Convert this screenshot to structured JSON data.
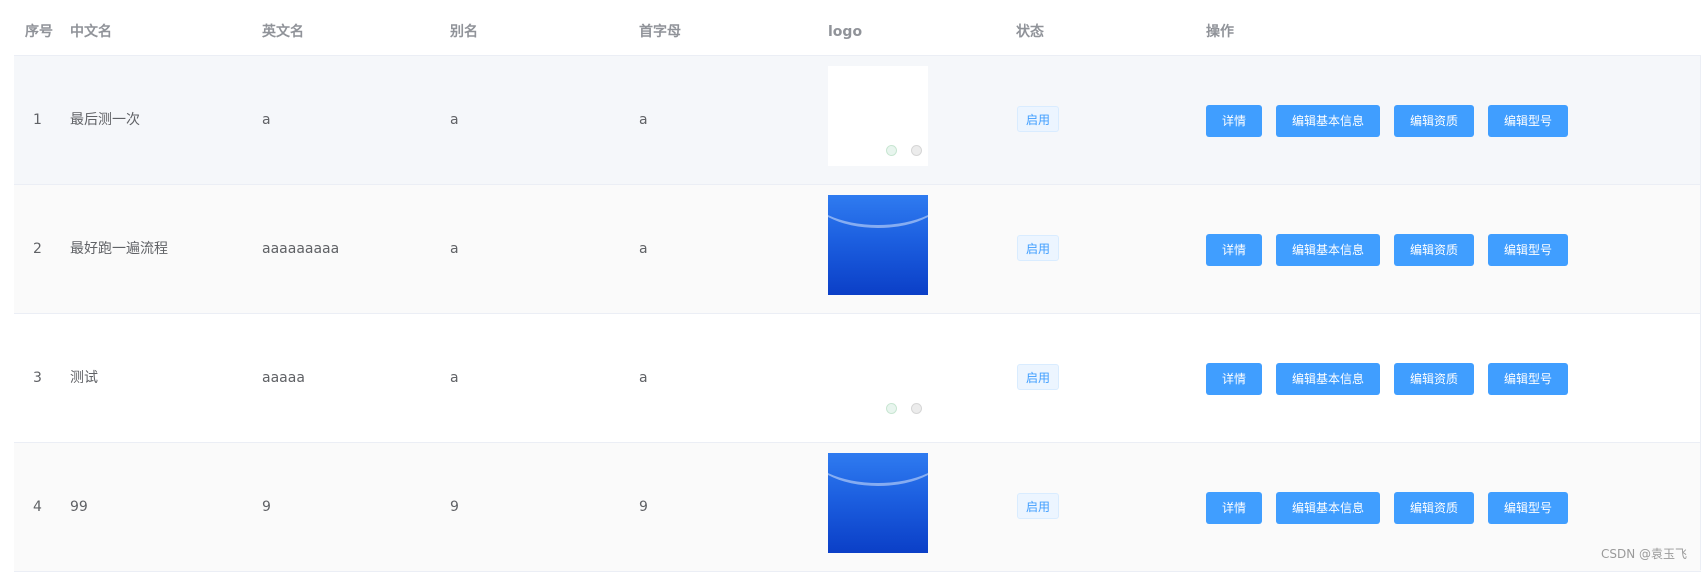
{
  "table": {
    "columns": {
      "index": "序号",
      "cn_name": "中文名",
      "en_name": "英文名",
      "alias": "别名",
      "initial": "首字母",
      "logo": "logo",
      "status": "状态",
      "actions": "操作"
    },
    "rows": [
      {
        "index": "1",
        "cn_name": "最后测一次",
        "en_name": "a",
        "alias": "a",
        "initial": "a",
        "logo": "white-screenshot-image",
        "status": "启用"
      },
      {
        "index": "2",
        "cn_name": "最好跑一遍流程",
        "en_name": "aaaaaaaaa",
        "alias": "a",
        "initial": "a",
        "logo": "blue-gradient-image",
        "status": "启用"
      },
      {
        "index": "3",
        "cn_name": "测试",
        "en_name": "aaaaa",
        "alias": "a",
        "initial": "a",
        "logo": "white-screenshot-image",
        "status": "启用"
      },
      {
        "index": "4",
        "cn_name": "99",
        "en_name": "9",
        "alias": "9",
        "initial": "9",
        "logo": "blue-gradient-image",
        "status": "启用"
      }
    ],
    "action_labels": {
      "detail": "详情",
      "edit_basic": "编辑基本信息",
      "edit_qualification": "编辑资质",
      "edit_model": "编辑型号"
    }
  },
  "colors": {
    "primary": "#409eff",
    "header_text": "#909399",
    "body_text": "#606266",
    "row_hover": "#f5f7fa",
    "row_stripe": "#fafafa",
    "border": "#ebeef5"
  },
  "watermark": "CSDN @袁玉飞"
}
